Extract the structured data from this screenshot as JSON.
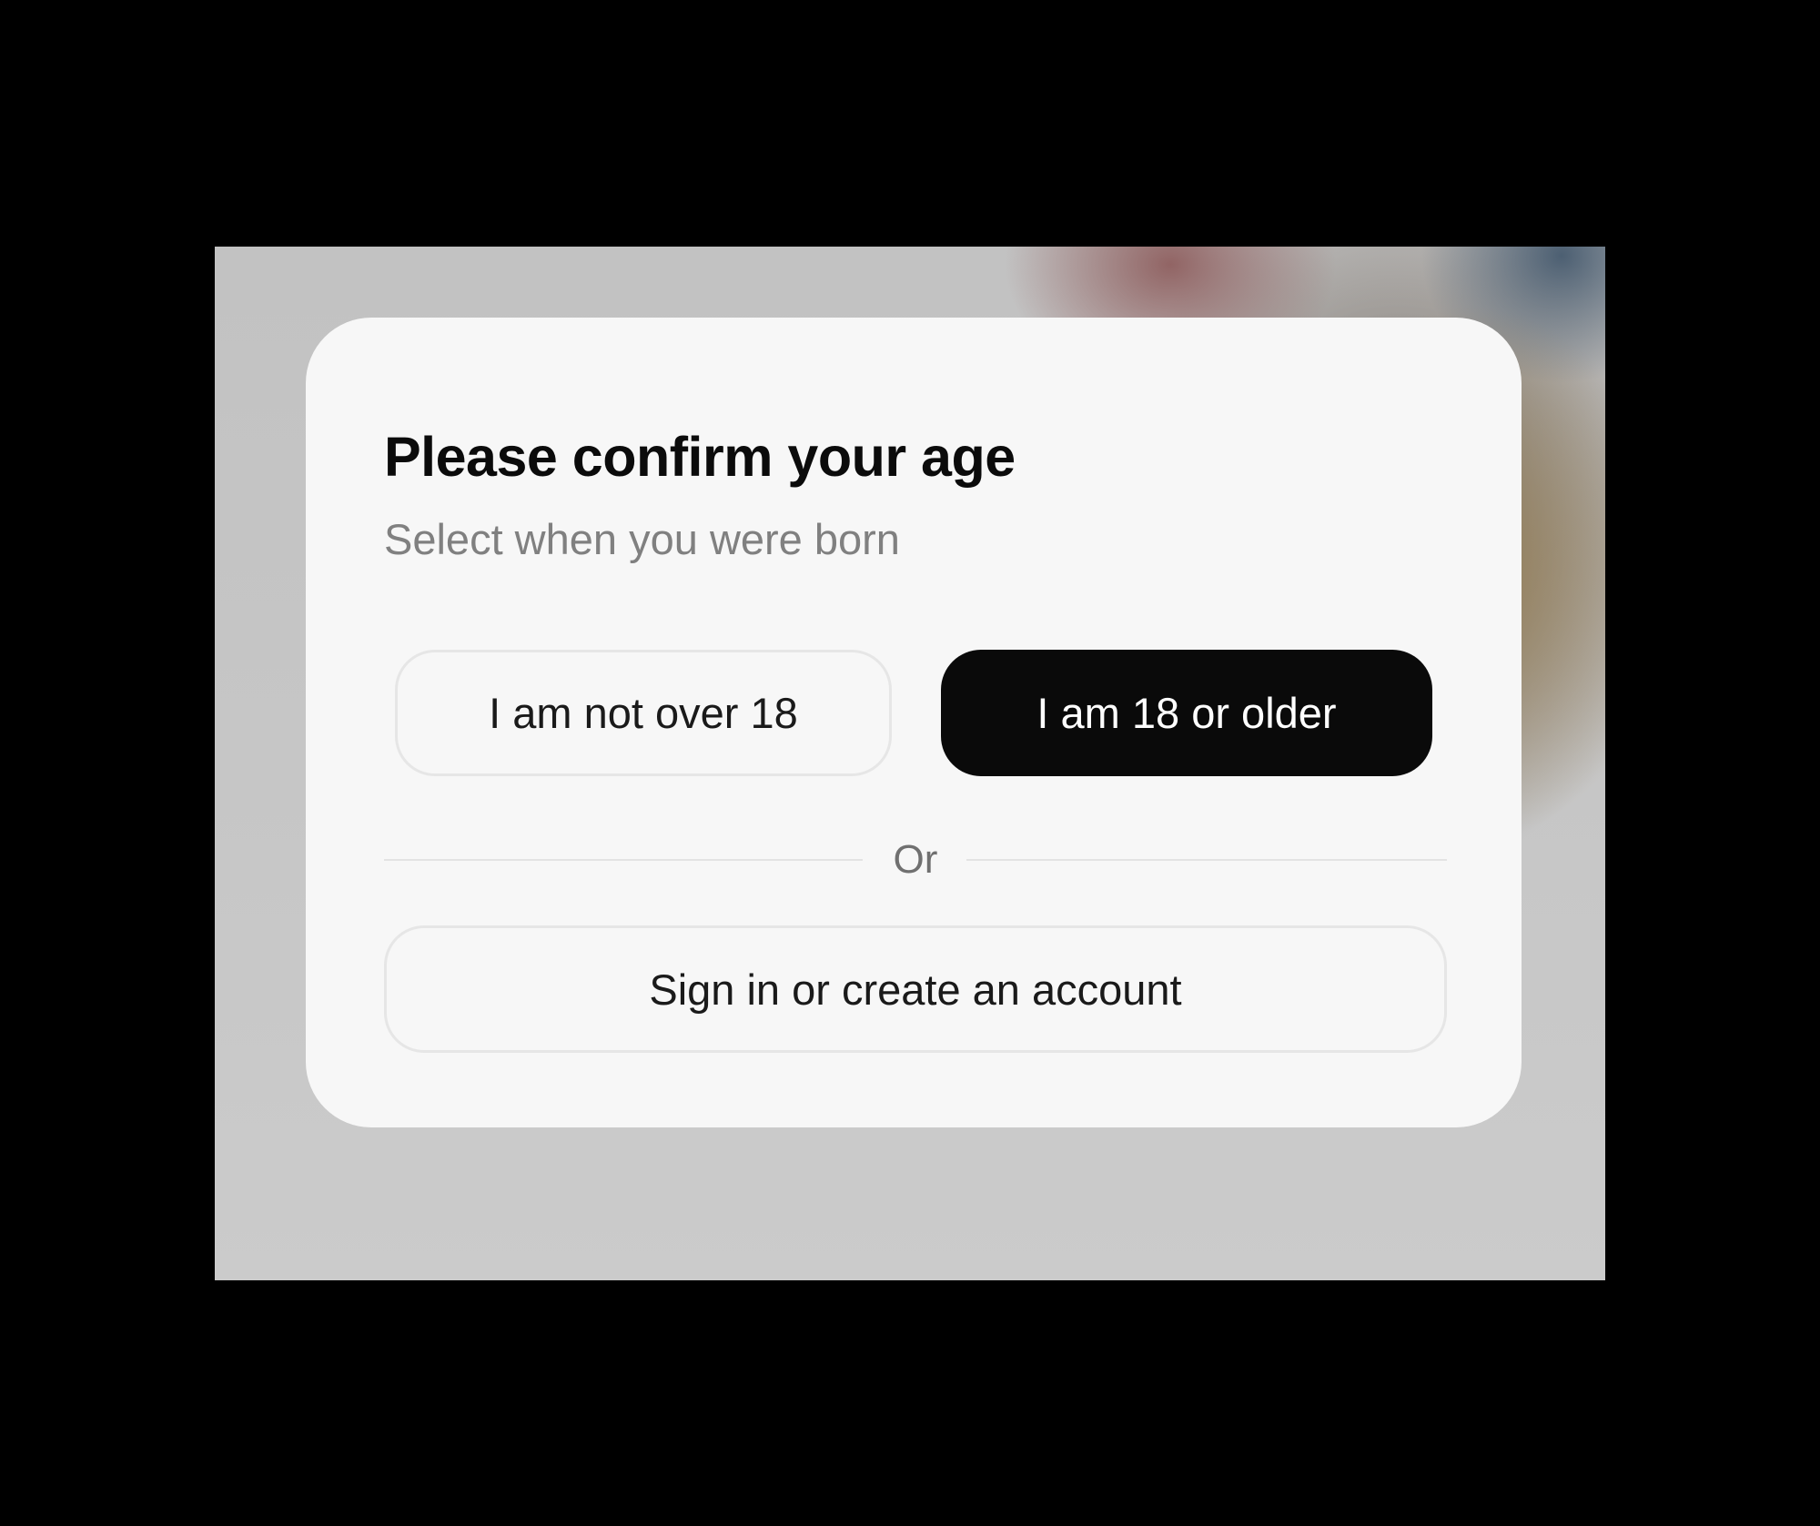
{
  "modal": {
    "title": "Please confirm your age",
    "subtitle": "Select when you were born",
    "options": {
      "not_over_18": "I am not over 18",
      "over_18": "I am 18 or older"
    },
    "divider_text": "Or",
    "signin_label": "Sign in or create an account"
  },
  "colors": {
    "page_background": "#000000",
    "modal_background": "#f7f7f7",
    "primary_button": "#0a0a0a",
    "primary_button_text": "#ffffff",
    "secondary_text": "#808080"
  }
}
